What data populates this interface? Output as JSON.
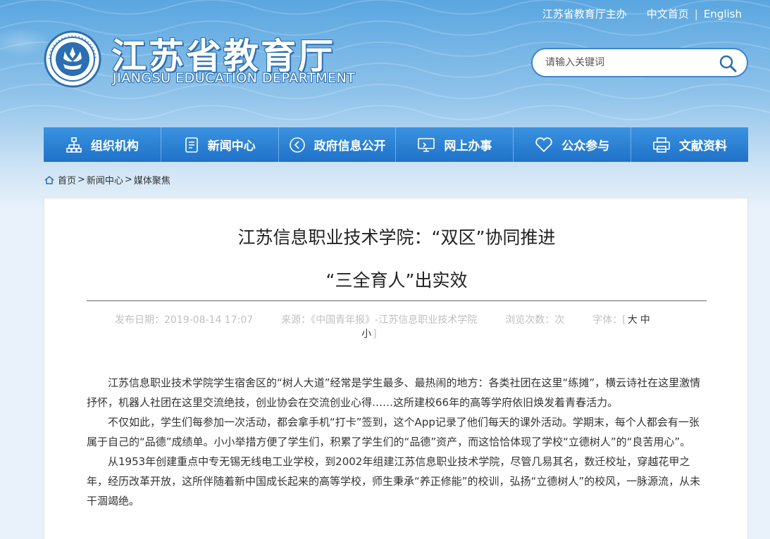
{
  "header": {
    "host_link": "江苏省教育厅主办",
    "chinese_home": "中文首页",
    "separator": "|",
    "english": "English",
    "logo_cn": "江苏省教育厅",
    "logo_en": "JIANGSU EDUCATION DEPARTMENT"
  },
  "search": {
    "placeholder": "请输入关键词"
  },
  "nav": {
    "items": [
      {
        "label": "组织机构",
        "icon": "org-chart-icon"
      },
      {
        "label": "新闻中心",
        "icon": "document-icon"
      },
      {
        "label": "政府信息公开",
        "icon": "megaphone-icon"
      },
      {
        "label": "网上办事",
        "icon": "monitor-icon"
      },
      {
        "label": "公众参与",
        "icon": "heart-icon"
      },
      {
        "label": "文献资料",
        "icon": "printer-icon"
      }
    ]
  },
  "breadcrumb": {
    "home": "首页",
    "news": "新闻中心",
    "current": "媒体聚焦",
    "gt": ">"
  },
  "article": {
    "title_line1": "江苏信息职业技术学院：“双区”协同推进",
    "title_line2": "“三全育人”出实效",
    "publish_label": "发布日期：2019-08-14 17:07",
    "source_label": "来源：《中国青年报》-江苏信息职业技术学院",
    "views_label": "浏览次数：次",
    "font_label": "字体：[",
    "font_large": "大",
    "font_medium": "中",
    "font_small": "小",
    "font_close": "]",
    "paragraphs": [
      "江苏信息职业技术学院学生宿舍区的“树人大道”经常是学生最多、最热闹的地方：各类社团在这里“练摊”，横云诗社在这里激情抒怀，机器人社团在这里交流绝技，创业协会在交流创业心得……这所建校66年的高等学府依旧焕发着青春活力。",
      "不仅如此，学生们每参加一次活动，都会拿手机“打卡”签到，这个App记录了他们每天的课外活动。学期末，每个人都会有一张属于自己的“品德”成绩单。小小举措方便了学生们，积累了学生们的“品德”资产，而这恰恰体现了学校“立德树人”的“良苦用心”。",
      "从1953年创建重点中专无锡无线电工业学校，到2002年组建江苏信息职业技术学院，尽管几易其名，数迁校址，穿越花甲之年，经历改革开放，这所伴随着新中国成长起来的高等学校，师生秉承“养正修能”的校训，弘扬“立德树人”的校风，一脉源流，从未干涸竭绝。"
    ]
  }
}
